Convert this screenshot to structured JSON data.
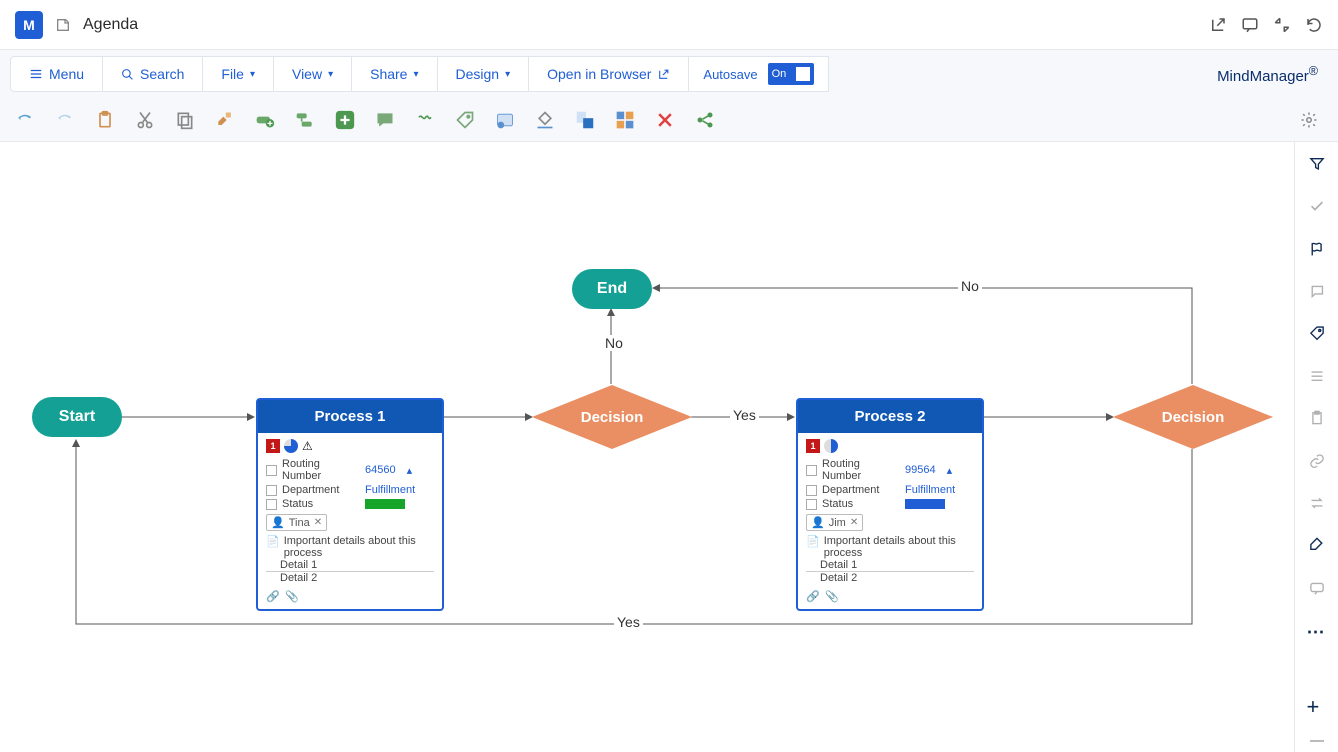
{
  "header": {
    "logo_letter": "M",
    "doc_title": "Agenda"
  },
  "menu": {
    "menu": "Menu",
    "search": "Search",
    "file": "File",
    "view": "View",
    "share": "Share",
    "design": "Design",
    "open_browser": "Open in Browser",
    "autosave": "Autosave",
    "autosave_state": "On",
    "brand": "MindManager"
  },
  "flowchart": {
    "start": "Start",
    "end": "End",
    "decision": "Decision",
    "yes": "Yes",
    "no": "No",
    "process1": {
      "title": "Process 1",
      "priority": "1",
      "routing_label": "Routing Number",
      "routing_value": "64560",
      "dept_label": "Department",
      "dept_value": "Fulfillment",
      "status_label": "Status",
      "status_color": "#17a42b",
      "assignee": "Tina",
      "note_title": "Important details about this process",
      "detail1": "Detail 1",
      "detail2": "Detail 2"
    },
    "process2": {
      "title": "Process 2",
      "priority": "1",
      "routing_label": "Routing Number",
      "routing_value": "99564",
      "dept_label": "Department",
      "dept_value": "Fulfillment",
      "status_label": "Status",
      "status_color": "#1f5ed4",
      "assignee": "Jim",
      "note_title": "Important details about this process",
      "detail1": "Detail 1",
      "detail2": "Detail 2"
    }
  }
}
